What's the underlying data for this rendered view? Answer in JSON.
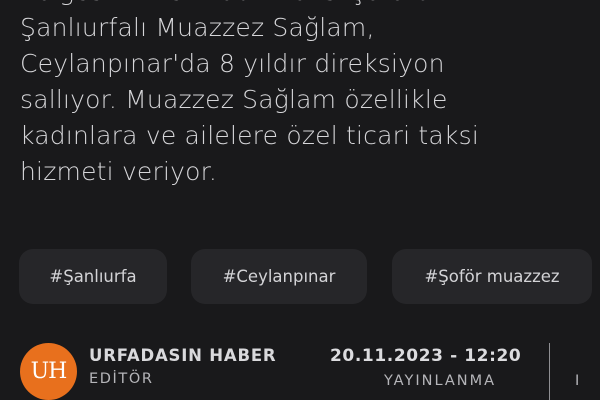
{
  "article": {
    "lines": [
      "Bölgesinin tek kadın taksi şoförü",
      "Şanlıurfalı Muazzez Sağlam,",
      "Ceylanpınar'da 8 yıldır direksiyon",
      "sallıyor. Muazzez Sağlam özellikle",
      "kadınlara ve ailelere özel ticari taksi",
      "hizmeti veriyor."
    ]
  },
  "tags": [
    "#Şanlıurfa",
    "#Ceylanpınar",
    "#Şoför muazzez"
  ],
  "author": {
    "initials": "UH",
    "name": "URFADASIN HABER",
    "role": "EDİTÖR",
    "avatar_color": "#e8701d"
  },
  "meta": {
    "date": "20.11.2023 - 12:20",
    "status": "YAYINLANMA",
    "next_label_partial": "I"
  },
  "colors": {
    "background": "#19191b",
    "tag_background": "#262629",
    "text": "#d9d9dc"
  }
}
